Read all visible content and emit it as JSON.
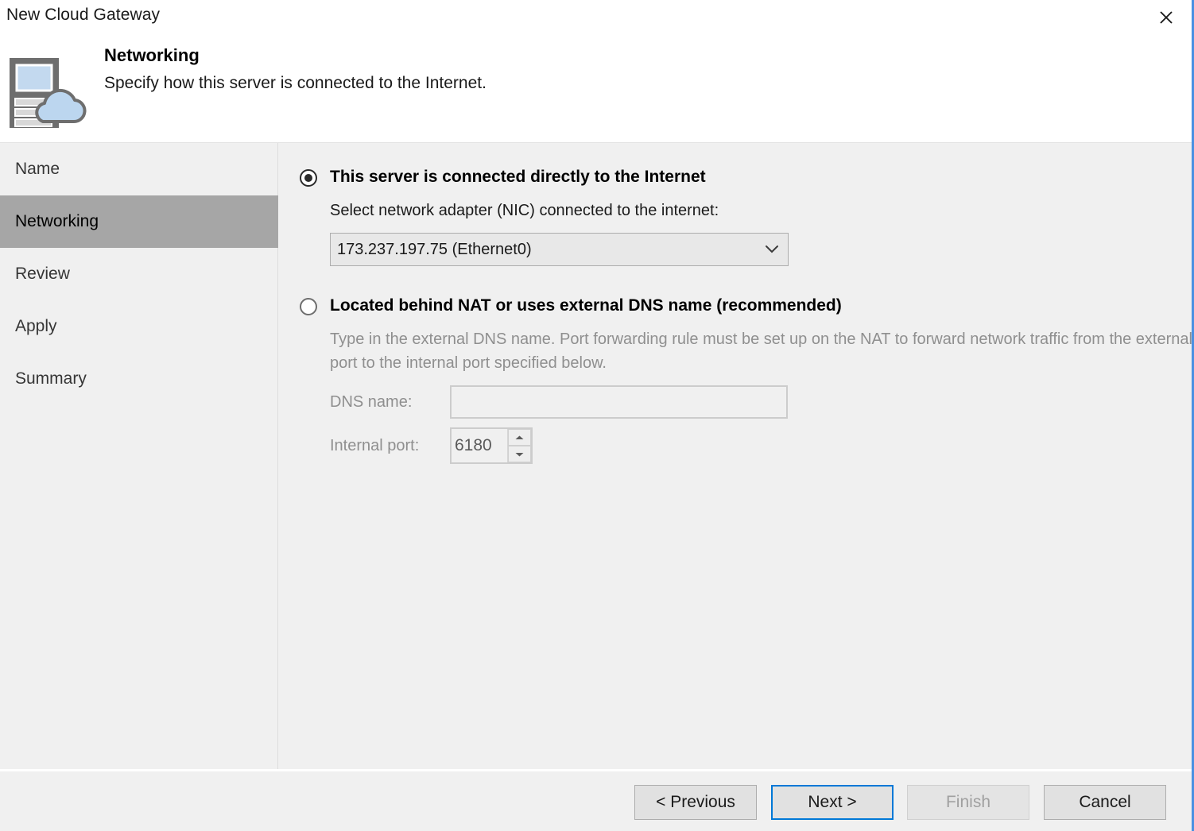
{
  "window": {
    "title": "New Cloud Gateway",
    "close_label": "✕",
    "accent_color": "#4a90e2"
  },
  "header": {
    "icon": "server-cloud-icon",
    "title": "Networking",
    "subtitle": "Specify how this server is connected to the Internet."
  },
  "sidebar": {
    "items": [
      {
        "label": "Name",
        "selected": false
      },
      {
        "label": "Networking",
        "selected": true
      },
      {
        "label": "Review",
        "selected": false
      },
      {
        "label": "Apply",
        "selected": false
      },
      {
        "label": "Summary",
        "selected": false
      }
    ],
    "selected_color": "#a6a6a6"
  },
  "main": {
    "option_direct": {
      "label": "This server is connected directly to the Internet",
      "checked": true,
      "nic_label": "Select network adapter (NIC) connected to the internet:",
      "nic_value": "173.237.197.75 (Ethernet0)",
      "nic_options": [
        "173.237.197.75 (Ethernet0)"
      ]
    },
    "option_nat": {
      "label": "Located behind NAT or uses external DNS name (recommended)",
      "checked": false,
      "description": "Type in the external DNS name. Port forwarding rule must be set up on the NAT to forward network traffic from the external port to the internal port specified below.",
      "dns_label": "DNS name:",
      "dns_value": "",
      "dns_placeholder": "",
      "port_label": "Internal port:",
      "port_value": "6180"
    }
  },
  "footer": {
    "previous_label": "< Previous",
    "next_label": "Next >",
    "finish_label": "Finish",
    "cancel_label": "Cancel",
    "finish_enabled": false,
    "next_is_default": true
  }
}
